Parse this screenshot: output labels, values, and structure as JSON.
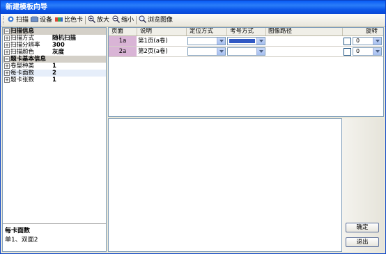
{
  "window": {
    "title": "新建模板向导"
  },
  "toolbar": {
    "scan": "扫描",
    "device": "设备",
    "color_card": "比色卡",
    "zoom_in": "放大",
    "zoom_out": "缩小",
    "browse": "浏览图像"
  },
  "properties": {
    "scan_info": "扫描信息",
    "scan_mode_key": "扫描方式",
    "scan_mode_val": "随机扫描",
    "resolution_key": "扫描分辨率",
    "resolution_val": "300",
    "color_key": "扫描颜色",
    "color_val": "灰度",
    "card_info": "题卡基本信息",
    "volume_key": "卷型种类",
    "volume_val": "1",
    "sides_key": "每卡面数",
    "sides_val": "2",
    "cards_key": "题卡张数",
    "cards_val": "1"
  },
  "description": {
    "title": "每卡面数",
    "text": "单1、双面2"
  },
  "grid": {
    "headers": [
      "页面",
      "说明",
      "定位方式",
      "考号方式",
      "图像路径",
      "旋转"
    ],
    "rows": [
      {
        "page": "1a",
        "desc": "第1页(a卷)",
        "rotate": "0"
      },
      {
        "page": "2a",
        "desc": "第2页(a卷)",
        "rotate": "0"
      }
    ]
  },
  "buttons": {
    "ok": "确定",
    "exit": "退出"
  },
  "colors": {
    "title_bar": "#0a5cf5",
    "page_cell": "#d9b4d6",
    "selected_combo": "#3159c4"
  }
}
